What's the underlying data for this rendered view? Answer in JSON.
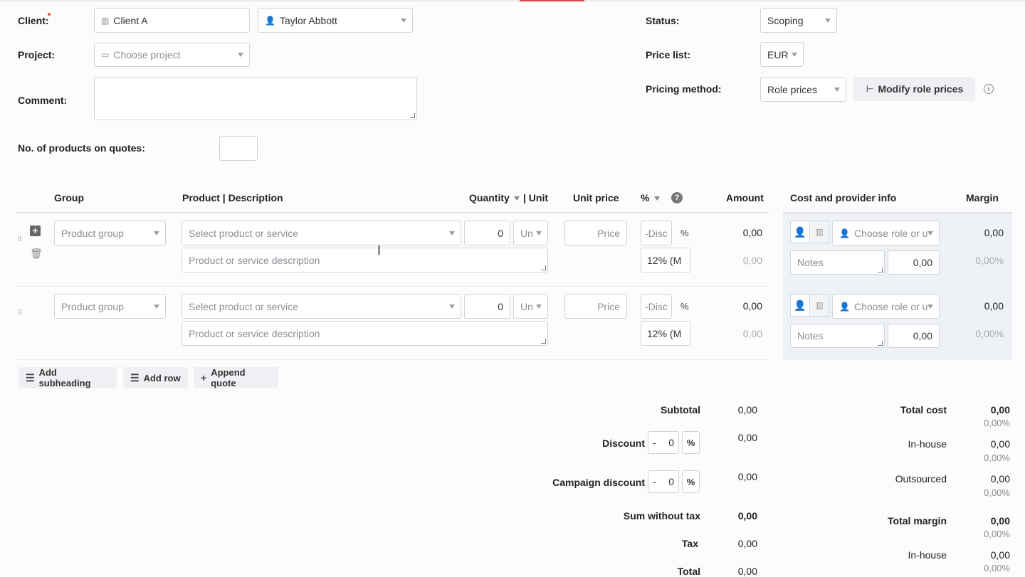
{
  "form": {
    "client_label": "Client:",
    "client_value": "Client A",
    "contact_value": "Taylor Abbott",
    "project_label": "Project:",
    "project_placeholder": "Choose project",
    "comment_label": "Comment:",
    "products_count_label": "No. of products on quotes:",
    "status_label": "Status:",
    "status_value": "Scoping",
    "price_list_label": "Price list:",
    "price_list_value": "EUR",
    "pricing_method_label": "Pricing method:",
    "pricing_method_value": "Role prices",
    "modify_role_prices": "Modify role prices"
  },
  "table": {
    "headers": {
      "group": "Group",
      "product": "Product | Description",
      "quantity": "Quantity",
      "unit": "| Unit",
      "unit_price": "Unit price",
      "percent": "%",
      "amount": "Amount",
      "cost": "Cost and provider info",
      "margin": "Margin"
    },
    "rows": [
      {
        "group_placeholder": "Product group",
        "product_placeholder": "Select product or service",
        "description_placeholder": "Product or service description",
        "quantity": "0",
        "unit_placeholder": "Un",
        "price_placeholder": "Price",
        "discount_placeholder": "-Disc",
        "percent_sign": "%",
        "vat": "12% (M",
        "amount": "0,00",
        "amount_sub": "0,00",
        "role_placeholder": "Choose role or u",
        "notes_placeholder": "Notes",
        "cost": "0,00",
        "margin": "0,00",
        "margin_pct": "0,00%"
      },
      {
        "group_placeholder": "Product group",
        "product_placeholder": "Select product or service",
        "description_placeholder": "Product or service description",
        "quantity": "0",
        "unit_placeholder": "Un",
        "price_placeholder": "Price",
        "discount_placeholder": "-Disc",
        "percent_sign": "%",
        "vat": "12% (M",
        "amount": "0,00",
        "amount_sub": "0,00",
        "role_placeholder": "Choose role or u",
        "notes_placeholder": "Notes",
        "cost": "0,00",
        "margin": "0,00",
        "margin_pct": "0,00%"
      }
    ]
  },
  "actions": {
    "add_subheading": "Add subheading",
    "add_row": "Add row",
    "append_quote": "Append quote"
  },
  "totals": {
    "subtotal_label": "Subtotal",
    "subtotal": "0,00",
    "discount_label": "Discount",
    "discount_sign": "-",
    "discount_value": "0",
    "discount_pct": "%",
    "discount_amount": "0,00",
    "campaign_label": "Campaign discount",
    "campaign_sign": "-",
    "campaign_value": "0",
    "campaign_pct": "%",
    "campaign_amount": "0,00",
    "sum_wo_tax_label": "Sum without tax",
    "sum_wo_tax": "0,00",
    "tax_label": "Tax",
    "tax": "0,00",
    "total_label": "Total",
    "total": "0,00"
  },
  "cost_summary": {
    "total_cost_label": "Total cost",
    "total_cost": "0,00",
    "total_cost_pct": "0,00%",
    "inhouse_label": "In-house",
    "inhouse": "0,00",
    "inhouse_pct": "0,00%",
    "outsourced_label": "Outsourced",
    "outsourced": "0,00",
    "outsourced_pct": "0,00%",
    "total_margin_label": "Total margin",
    "total_margin": "0,00",
    "total_margin_pct": "0,00%",
    "margin_inhouse_label": "In-house",
    "margin_inhouse": "0,00",
    "margin_inhouse_pct": "0,00%"
  },
  "colors": {
    "accent": "#1a73c8",
    "required": "#e8583a",
    "panel": "#eef2f7"
  }
}
